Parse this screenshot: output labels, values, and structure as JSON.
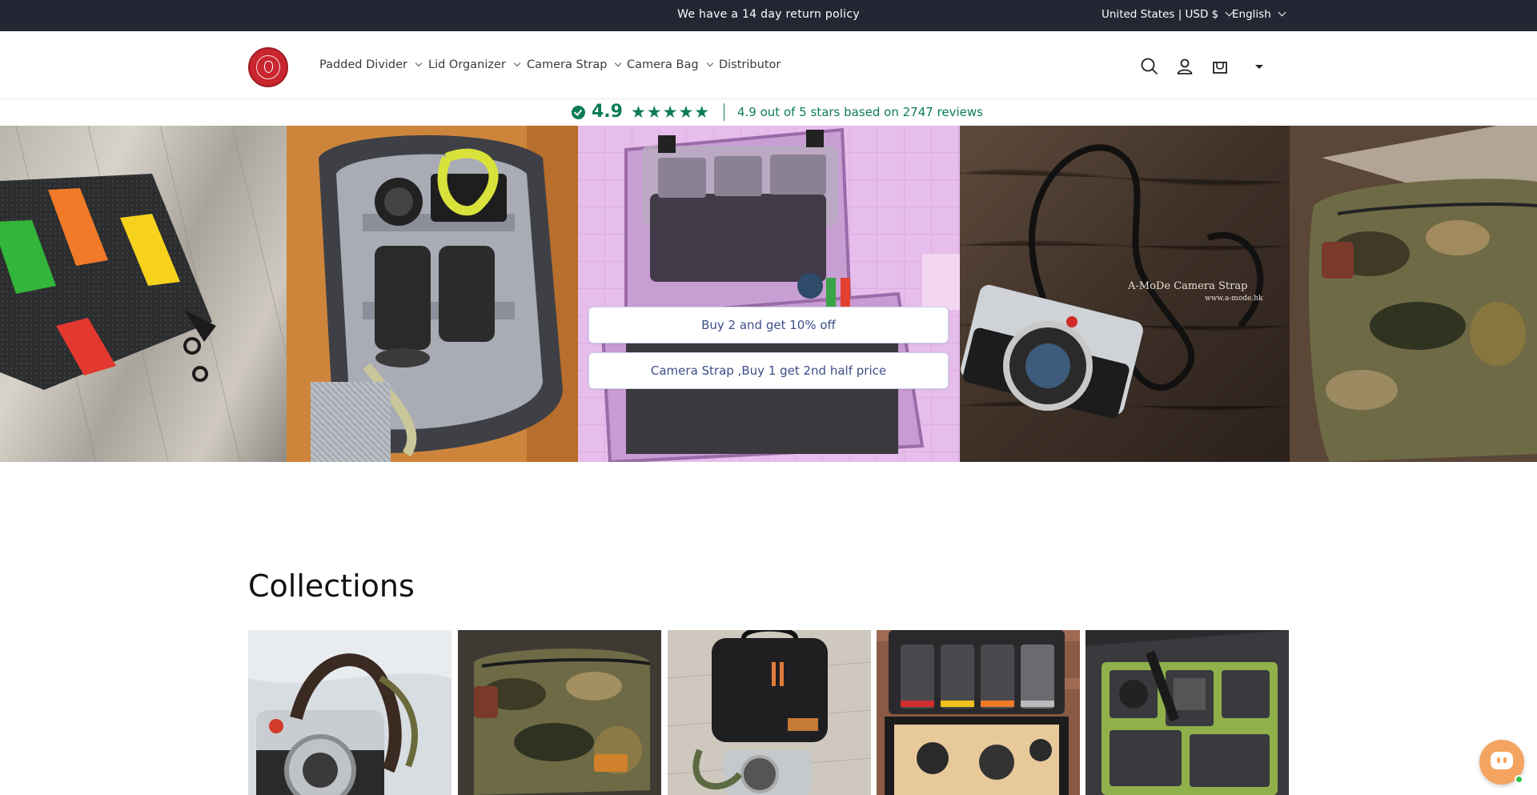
{
  "announcement": {
    "message": "We have a 14 day return policy",
    "country": "United States | USD $",
    "language": "English"
  },
  "header": {
    "nav": [
      {
        "label": "Padded Divider"
      },
      {
        "label": "Lid Organizer"
      },
      {
        "label": "Camera Strap"
      },
      {
        "label": "Camera Bag"
      },
      {
        "label": "Distributor"
      }
    ]
  },
  "rating": {
    "score": "4.9",
    "stars": "★★★★★",
    "summary": "4.9 out of 5 stars based on 2747 reviews"
  },
  "hero": {
    "promos": [
      {
        "label": "Buy 2 and get 10% off"
      },
      {
        "label": "Camera Strap ,Buy 1 get 2nd half price"
      }
    ],
    "watermark": {
      "line1": "A-MoDe Camera Strap",
      "line2": "www.a-mode.hk"
    }
  },
  "collections": {
    "title": "Collections"
  },
  "colors": {
    "announcement_bg": "#222733",
    "rating_green": "#0c7c59",
    "promo_text": "#3d4e8a",
    "chat_orange": "#f4a45e"
  }
}
